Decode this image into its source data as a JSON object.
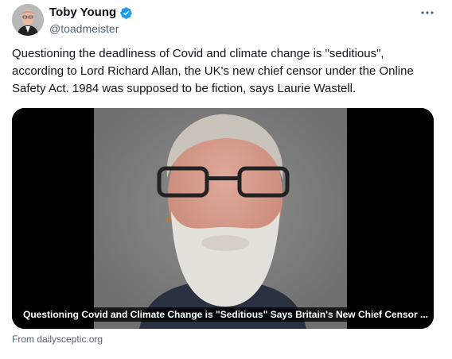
{
  "author": {
    "display_name": "Toby Young",
    "handle": "@toadmeister",
    "verified_color": "#1d9bf0"
  },
  "tweet": {
    "text": "Questioning the deadliness of Covid and climate change is \"seditious\", according to Lord Richard Allan, the UK's new chief censor under the Online Safety Act. 1984 was supposed to be fiction, says Laurie Wastell."
  },
  "card": {
    "caption": "Questioning Covid and Climate Change is \"Seditious\" Says Britain's New Chief Censor ...",
    "source": "From dailysceptic.org"
  },
  "icons": {
    "more": "more-horizontal-icon",
    "verified": "verified-badge-icon"
  }
}
